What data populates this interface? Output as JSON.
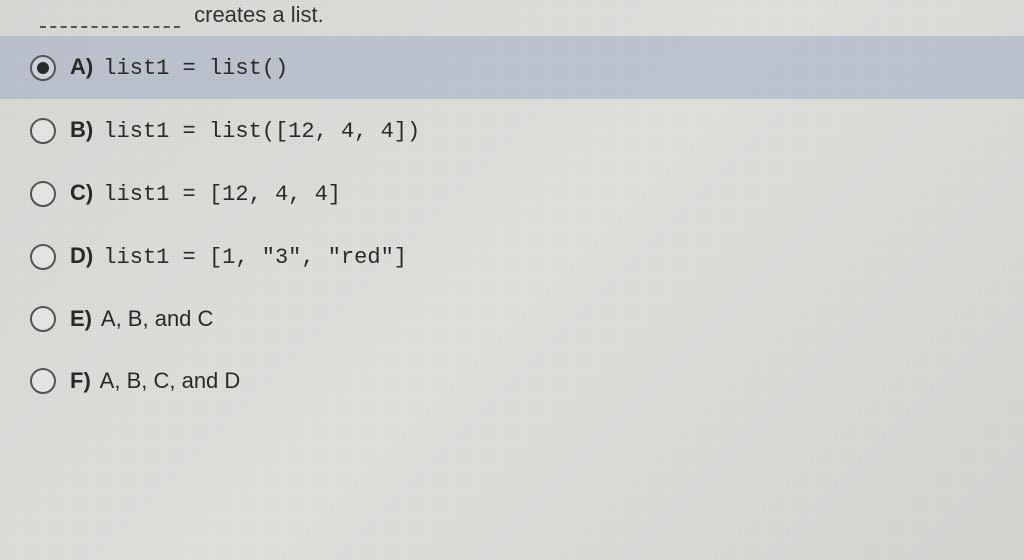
{
  "question": {
    "suffix_text": "creates a list."
  },
  "options": [
    {
      "letter": "A)",
      "text": "list1 = list()",
      "is_code": true,
      "selected": true
    },
    {
      "letter": "B)",
      "text": "list1 = list([12, 4, 4])",
      "is_code": true,
      "selected": false
    },
    {
      "letter": "C)",
      "text": "list1 = [12, 4, 4]",
      "is_code": true,
      "selected": false
    },
    {
      "letter": "D)",
      "text": "list1 = [1, \"3\", \"red\"]",
      "is_code": true,
      "selected": false
    },
    {
      "letter": "E)",
      "text": "A, B, and C",
      "is_code": false,
      "selected": false
    },
    {
      "letter": "F)",
      "text": "A, B, C, and D",
      "is_code": false,
      "selected": false
    }
  ]
}
